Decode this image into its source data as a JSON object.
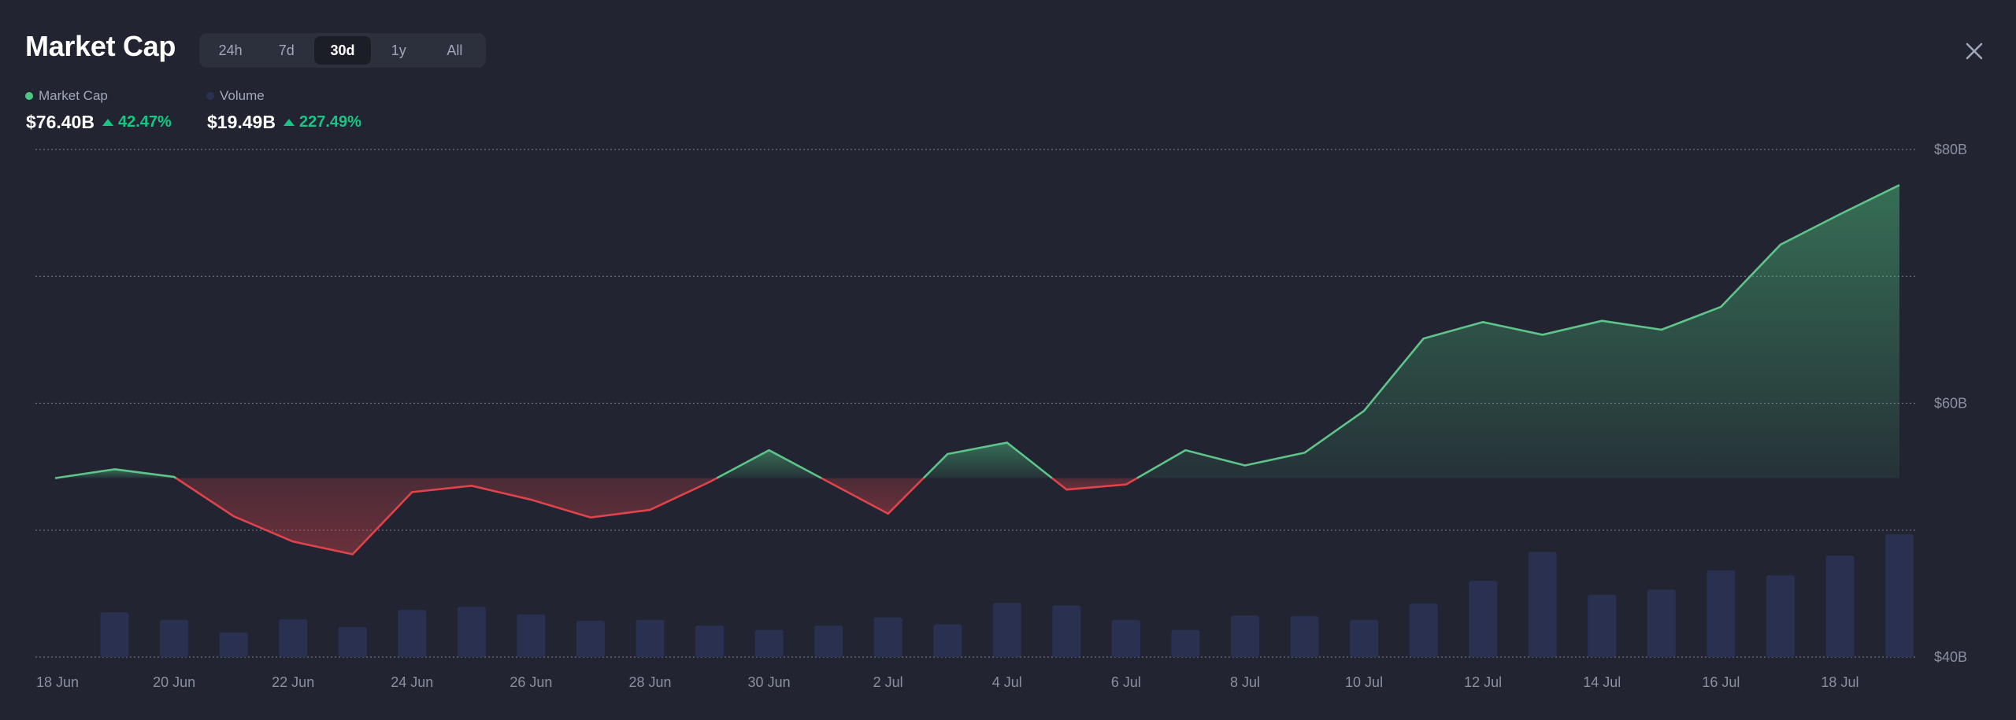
{
  "header": {
    "title": "Market Cap",
    "tabs": [
      "24h",
      "7d",
      "30d",
      "1y",
      "All"
    ],
    "active_tab": "30d"
  },
  "legend": {
    "market_cap": {
      "label": "Market Cap",
      "value": "$76.40B",
      "change": "42.47%",
      "color": "#4ec782"
    },
    "volume": {
      "label": "Volume",
      "value": "$19.49B",
      "change": "227.49%",
      "color": "#2a3150"
    }
  },
  "colors": {
    "background": "#222531",
    "up": "#5fc48a",
    "down": "#e0434b",
    "volume_bar": "#2a3150"
  },
  "chart_data": {
    "type": "line",
    "title": "",
    "xlabel": "",
    "ylabel": "",
    "ylim": [
      40,
      80
    ],
    "yticks": [
      "$80B",
      "$60B",
      "$40B"
    ],
    "ytick_values": [
      80,
      60,
      40
    ],
    "baseline": 54.1,
    "x": [
      "18 Jun",
      "19 Jun",
      "20 Jun",
      "21 Jun",
      "22 Jun",
      "23 Jun",
      "24 Jun",
      "25 Jun",
      "26 Jun",
      "27 Jun",
      "28 Jun",
      "29 Jun",
      "30 Jun",
      "1 Jul",
      "2 Jul",
      "3 Jul",
      "4 Jul",
      "5 Jul",
      "6 Jul",
      "7 Jul",
      "8 Jul",
      "9 Jul",
      "10 Jul",
      "11 Jul",
      "12 Jul",
      "13 Jul",
      "14 Jul",
      "15 Jul",
      "16 Jul",
      "17 Jul",
      "18 Jul",
      "19 Jul"
    ],
    "xticks": [
      "18 Jun",
      "20 Jun",
      "22 Jun",
      "24 Jun",
      "26 Jun",
      "28 Jun",
      "30 Jun",
      "2 Jul",
      "4 Jul",
      "6 Jul",
      "8 Jul",
      "10 Jul",
      "12 Jul",
      "14 Jul",
      "16 Jul",
      "18 Jul"
    ],
    "series": [
      {
        "name": "Market Cap",
        "unit": "B USD",
        "values": [
          54.1,
          54.8,
          54.2,
          51.1,
          49.1,
          48.1,
          53.0,
          53.5,
          52.4,
          51.0,
          51.6,
          53.8,
          56.3,
          53.8,
          51.3,
          56.0,
          56.9,
          53.2,
          53.6,
          56.3,
          55.1,
          56.1,
          59.4,
          65.1,
          66.4,
          65.4,
          66.5,
          65.8,
          67.6,
          72.5,
          74.9,
          77.2
        ]
      },
      {
        "name": "Volume",
        "unit": "B USD",
        "values": [
          null,
          7.1,
          5.9,
          3.9,
          6.0,
          4.8,
          7.5,
          8.0,
          6.8,
          5.8,
          5.9,
          5.0,
          4.3,
          5.0,
          6.3,
          5.2,
          8.6,
          8.2,
          5.9,
          4.3,
          6.6,
          6.5,
          5.9,
          8.5,
          12.1,
          16.7,
          9.9,
          10.7,
          13.8,
          13.0,
          16.1,
          19.5
        ]
      }
    ],
    "volume_ylim": [
      0,
      20
    ],
    "grid": true,
    "legend": "top-left"
  }
}
